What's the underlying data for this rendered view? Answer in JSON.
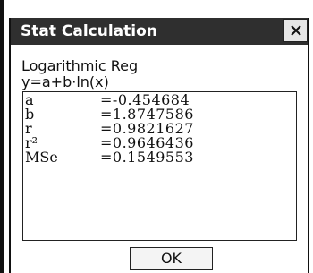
{
  "dialog": {
    "title": "Stat Calculation",
    "close_icon": "close-icon",
    "regression_type": "Logarithmic Reg",
    "equation": "y=a+b·ln(x)",
    "results": [
      {
        "label": "a",
        "value": "=-0.454684"
      },
      {
        "label": "b",
        "value": "=1.8747586"
      },
      {
        "label": "r",
        "value": "=0.9821627"
      },
      {
        "label": "r²",
        "value": "=0.9646436"
      },
      {
        "label": "MSe",
        "value": "=0.1549553"
      }
    ],
    "ok_label": "OK"
  },
  "colors": {
    "titlebar_bg": "#2f2f2f",
    "titlebar_text": "#ffffff",
    "background": "#ffffff",
    "border": "#222222"
  }
}
